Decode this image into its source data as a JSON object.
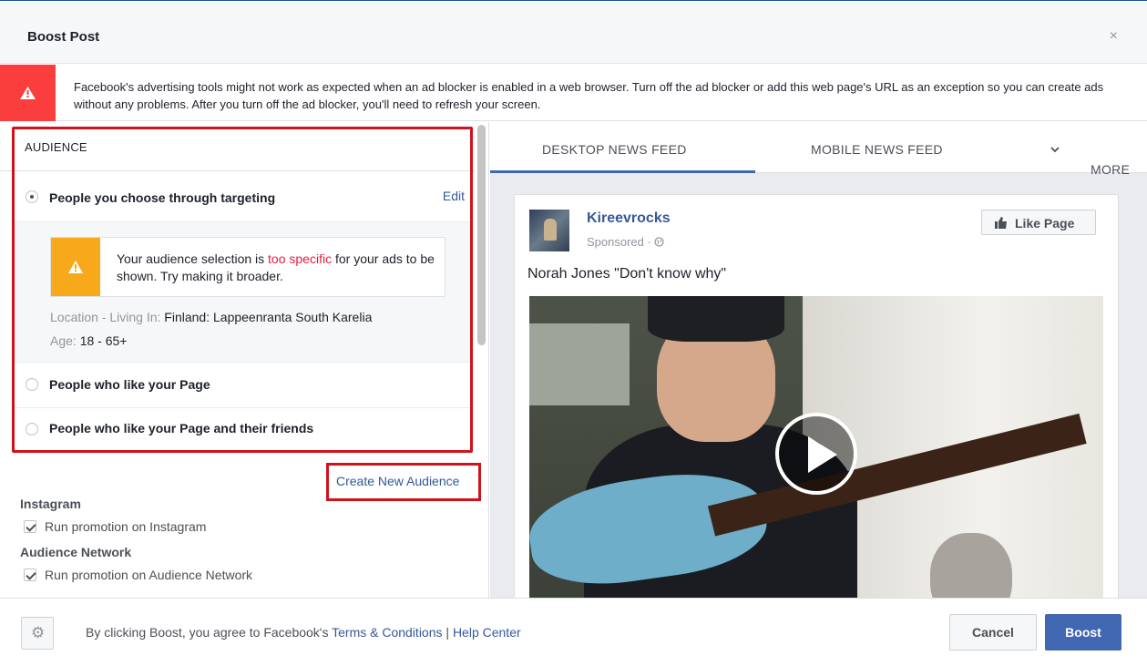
{
  "header": {
    "title": "Boost Post",
    "close_glyph": "×"
  },
  "banner": {
    "icon": "warning-triangle-icon",
    "text": "Facebook's advertising tools might not work as expected when an ad blocker is enabled in a web browser. Turn off the ad blocker or add this web page's URL as an exception so you can create ads without any problems. After you turn off the ad blocker, you'll need to refresh your screen.",
    "color": "#fa3e3e"
  },
  "audience": {
    "section_title": "AUDIENCE",
    "options": [
      {
        "label": "People you choose through targeting",
        "selected": true,
        "edit_label": "Edit"
      },
      {
        "label": "People who like your Page",
        "selected": false
      },
      {
        "label": "People who like your Page and their friends",
        "selected": false
      }
    ],
    "warning": {
      "icon": "warning-triangle-icon",
      "text_before": "Your audience selection is ",
      "highlight": "too specific",
      "text_after": " for your ads to be shown. Try making it broader.",
      "color": "#f7a81b"
    },
    "location_label": "Location - Living In:",
    "location_value": " Finland: Lappeenranta South Karelia",
    "age_label": "Age:",
    "age_value": " 18 - 65+",
    "create_new_label": "Create New Audience"
  },
  "platforms": {
    "instagram_title": "Instagram",
    "instagram_check": "Run promotion on Instagram",
    "network_title": "Audience Network",
    "network_check": "Run promotion on Audience Network"
  },
  "preview": {
    "tabs": [
      {
        "label": "DESKTOP NEWS FEED",
        "active": true
      },
      {
        "label": "MOBILE NEWS FEED",
        "active": false
      },
      {
        "label": "MORE",
        "active": false
      }
    ],
    "more_chevron": "⌄",
    "page_name": "Kireevrocks",
    "sponsored": "Sponsored · ",
    "globe": "globe-icon",
    "like_page_label": "Like Page",
    "caption": "Norah Jones \"Don't know why\""
  },
  "footer": {
    "text_before": "By clicking Boost, you agree to Facebook's ",
    "terms_label": "Terms & Conditions",
    "separator": " | ",
    "help_label": "Help Center",
    "cancel_label": "Cancel",
    "boost_label": "Boost",
    "accent": "#4267b2"
  }
}
